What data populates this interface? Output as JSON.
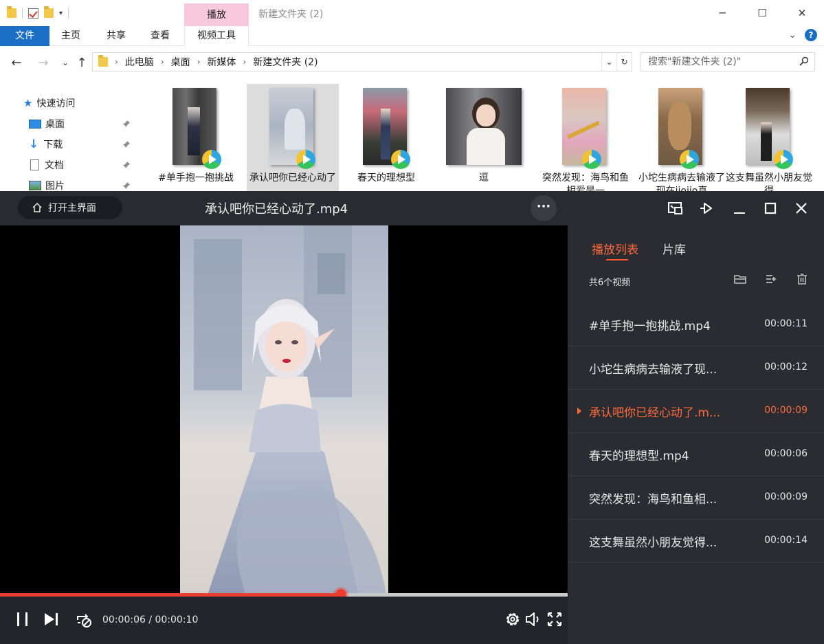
{
  "explorer": {
    "window_title": "新建文件夹 (2)",
    "context_tab": "播放",
    "ribbon_tabs": {
      "file": "文件",
      "home": "主页",
      "share": "共享",
      "view": "查看",
      "video_tools": "视频工具"
    },
    "breadcrumb": [
      "此电脑",
      "桌面",
      "新媒体",
      "新建文件夹 (2)"
    ],
    "search_placeholder": "搜索\"新建文件夹 (2)\"",
    "nav": {
      "quick_access": "快速访问",
      "items": [
        "桌面",
        "下载",
        "文档",
        "图片"
      ]
    },
    "files": [
      {
        "label": "#单手抱一抱挑战",
        "selected": false
      },
      {
        "label": "承认吧你已经心动了",
        "selected": true
      },
      {
        "label": "春天的理想型",
        "selected": false
      },
      {
        "label": "逗",
        "selected": false
      },
      {
        "label": "突然发现：海鸟和鱼相爱是一",
        "selected": false
      },
      {
        "label": "小坨生病病去输液了现在jiojio真",
        "selected": false
      },
      {
        "label": "这支舞虽然小朋友觉得",
        "selected": false
      }
    ]
  },
  "player": {
    "home_button": "打开主界面",
    "title": "承认吧你已经心动了.mp4",
    "time_current": "00:00:06",
    "time_total": "00:00:10",
    "time_display": "00:00:06 / 00:00:10",
    "progress": 0.6,
    "tabs": {
      "playlist": "播放列表",
      "library": "片库"
    },
    "count_label": "共6个视频",
    "playlist": [
      {
        "name": "#单手抱一抱挑战.mp4",
        "duration": "00:00:11",
        "current": false
      },
      {
        "name": "小坨生病病去输液了现...",
        "duration": "00:00:12",
        "current": false
      },
      {
        "name": "承认吧你已经心动了.m...",
        "duration": "00:00:09",
        "current": true
      },
      {
        "name": "春天的理想型.mp4",
        "duration": "00:00:06",
        "current": false
      },
      {
        "name": "突然发现：海鸟和鱼相...",
        "duration": "00:00:09",
        "current": false
      },
      {
        "name": "这支舞虽然小朋友觉得...",
        "duration": "00:00:14",
        "current": false
      }
    ],
    "accent_color": "#ff5a2c"
  }
}
